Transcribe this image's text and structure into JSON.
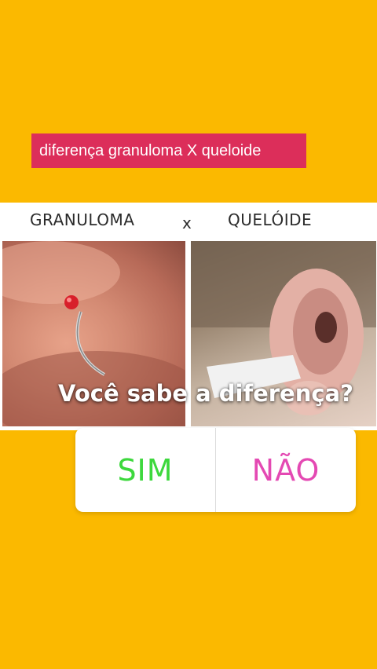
{
  "caption": "diferença granuloma X queloide",
  "labels": {
    "left": "GRANULOMA",
    "separator": "x",
    "right": "QUELÓIDE"
  },
  "question": "Você sabe a diferença?",
  "poll": {
    "options": [
      {
        "label": "SIM",
        "color": "#3DD83D"
      },
      {
        "label": "NÃO",
        "color": "#E449B3"
      }
    ]
  },
  "colors": {
    "background": "#FBB900",
    "caption_background": "#DC2E5A"
  }
}
